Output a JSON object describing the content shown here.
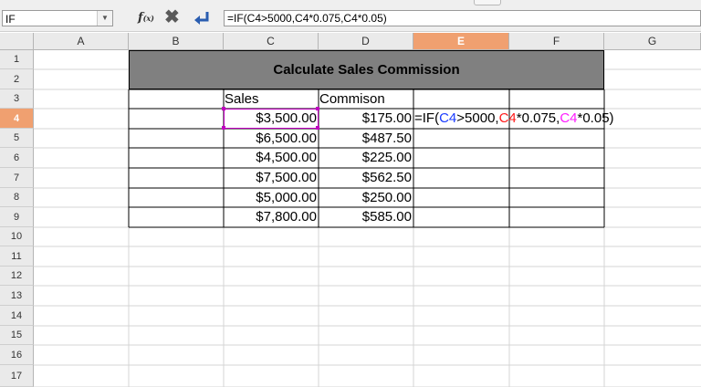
{
  "name_box": {
    "value": "IF"
  },
  "formula_bar": {
    "value": "=IF(C4>5000,C4*0.075,C4*0.05)"
  },
  "columns": [
    "A",
    "B",
    "C",
    "D",
    "E",
    "F",
    "G"
  ],
  "active_column": "E",
  "rows": [
    "1",
    "2",
    "3",
    "4",
    "5",
    "6",
    "7",
    "8",
    "9",
    "10",
    "11",
    "12",
    "13",
    "14",
    "15",
    "16",
    "17"
  ],
  "active_row": "4",
  "title": "Calculate Sales Commission",
  "headers": {
    "sales": "Sales",
    "commission": "Commison"
  },
  "table": [
    {
      "sales": "$3,500.00",
      "commission": "$175.00"
    },
    {
      "sales": "$6,500.00",
      "commission": "$487.50"
    },
    {
      "sales": "$4,500.00",
      "commission": "$225.00"
    },
    {
      "sales": "$7,500.00",
      "commission": "$562.50"
    },
    {
      "sales": "$5,000.00",
      "commission": "$250.00"
    },
    {
      "sales": "$7,800.00",
      "commission": "$585.00"
    }
  ],
  "edit_formula": {
    "p1": "=IF(",
    "r1": "C4",
    "p2": ">5000,",
    "r2": "C4",
    "p3": "*0.075,",
    "r3": "C4",
    "p4": "*0.05)"
  },
  "colors": {
    "ref_blue": "#1a3bff",
    "ref_red": "#ff1a1a",
    "ref_magenta": "#ff1aff",
    "header_active": "#f0a070",
    "title_fill": "#808080"
  }
}
